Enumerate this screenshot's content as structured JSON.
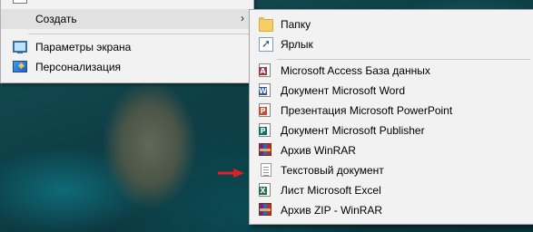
{
  "context_menu": {
    "items": [
      {
        "label": "Создать",
        "has_submenu": true,
        "highlighted": true
      },
      {
        "label": "Параметры экрана",
        "icon": "display-settings-icon"
      },
      {
        "label": "Персонализация",
        "icon": "personalization-icon"
      }
    ],
    "submenu_chevron": "›"
  },
  "submenu": {
    "items": [
      {
        "label": "Папку",
        "icon": "folder-icon"
      },
      {
        "label": "Ярлык",
        "icon": "shortcut-icon"
      },
      {
        "label": "Microsoft Access База данных",
        "icon": "access-icon",
        "badge": "A",
        "color": "#a4373a"
      },
      {
        "label": "Документ Microsoft Word",
        "icon": "word-icon",
        "badge": "W",
        "color": "#2b579a"
      },
      {
        "label": "Презентация Microsoft PowerPoint",
        "icon": "powerpoint-icon",
        "badge": "P",
        "color": "#d24726"
      },
      {
        "label": "Документ Microsoft Publisher",
        "icon": "publisher-icon",
        "badge": "P",
        "color": "#077568"
      },
      {
        "label": "Архив WinRAR",
        "icon": "winrar-icon"
      },
      {
        "label": "Текстовый документ",
        "icon": "text-document-icon"
      },
      {
        "label": "Лист Microsoft Excel",
        "icon": "excel-icon",
        "badge": "X",
        "color": "#217346"
      },
      {
        "label": "Архив ZIP - WinRAR",
        "icon": "winrar-zip-icon"
      }
    ]
  },
  "colors": {
    "arrow": "#e02020",
    "menu_bg": "#f2f2f2",
    "highlight": "#e1e1e1"
  }
}
